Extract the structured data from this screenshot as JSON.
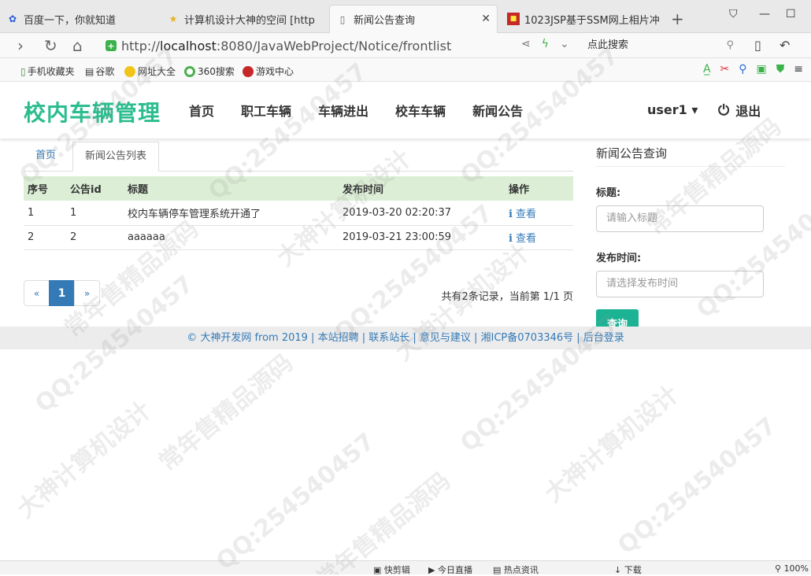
{
  "browser": {
    "tabs": [
      {
        "title": "百度一下，你就知道",
        "icon": "baidu-paw-icon"
      },
      {
        "title": "计算机设计大神的空间 [http",
        "icon": "star-icon"
      },
      {
        "title": "新闻公告查询",
        "icon": "page-icon"
      },
      {
        "title": "1023JSP基于SSM网上相片冲",
        "icon": "red-square-icon"
      }
    ],
    "url_prefix": "http://",
    "url_host": "localhost",
    "url_rest": ":8080/JavaWebProject/Notice/frontlist",
    "search_placeholder": "点此搜索",
    "bookmarks": [
      "手机收藏夹",
      "谷歌",
      "网址大全",
      "360搜索",
      "游戏中心"
    ]
  },
  "site": {
    "brand": "校内车辆管理",
    "menu": [
      "首页",
      "职工车辆",
      "车辆进出",
      "校车车辆",
      "新闻公告"
    ],
    "user": "user1 ▾",
    "logout": "退出"
  },
  "main": {
    "tabs": [
      "首页",
      "新闻公告列表"
    ],
    "columns": [
      "序号",
      "公告id",
      "标题",
      "发布时间",
      "操作"
    ],
    "rows": [
      [
        "1",
        "1",
        "校内车辆停车管理系统开通了",
        "2019-03-20 02:20:37",
        "查看"
      ],
      [
        "2",
        "2",
        "aaaaaa",
        "2019-03-21 23:00:59",
        "查看"
      ]
    ],
    "pager": [
      "«",
      "1",
      "»"
    ],
    "count": "共有2条记录，当前第 1/1 页"
  },
  "side": {
    "title": "新闻公告查询",
    "title_label": "标题:",
    "title_placeholder": "请输入标题",
    "time_label": "发布时间:",
    "time_placeholder": "请选择发布时间",
    "button": "查询"
  },
  "footer": "© 大神开发网 from 2019 | 本站招聘 | 联系站长 | 意见与建议 | 湘ICP备0703346号 | 后台登录",
  "statusbar": [
    "快剪辑",
    "今日直播",
    "热点资讯",
    "下载",
    "100%"
  ],
  "watermark": [
    "QQ:254540457",
    "大神计算机设计",
    "常年售精品源码"
  ],
  "colors": {
    "brand": "#2bbd8e",
    "table_header": "#dcefd6",
    "query_button": "#1cb394",
    "link": "#337ab7"
  }
}
